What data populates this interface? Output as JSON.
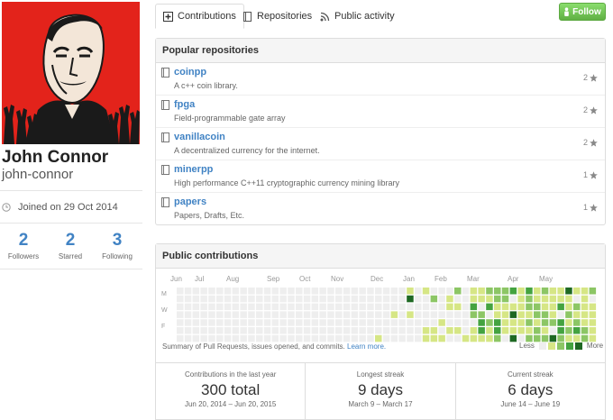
{
  "profile": {
    "fullname": "John Connor",
    "username": "john-connor",
    "joined": "Joined on 29 Oct 2014",
    "stats": [
      {
        "num": "2",
        "label": "Followers"
      },
      {
        "num": "2",
        "label": "Starred"
      },
      {
        "num": "3",
        "label": "Following"
      }
    ]
  },
  "tabs": [
    {
      "label": "Contributions",
      "icon": "contributions-icon",
      "active": true
    },
    {
      "label": "Repositories",
      "icon": "repo-icon",
      "active": false
    },
    {
      "label": "Public activity",
      "icon": "rss-icon",
      "active": false
    }
  ],
  "follow": {
    "label": "Follow"
  },
  "popular": {
    "title": "Popular repositories",
    "repos": [
      {
        "name": "coinpp",
        "desc": "A c++ coin library.",
        "stars": "2"
      },
      {
        "name": "fpga",
        "desc": "Field-programmable gate array",
        "stars": "2"
      },
      {
        "name": "vanillacoin",
        "desc": "A decentralized currency for the internet.",
        "stars": "2"
      },
      {
        "name": "minerpp",
        "desc": "High performance C++11 cryptographic currency mining library",
        "stars": "1"
      },
      {
        "name": "papers",
        "desc": "Papers, Drafts, Etc.",
        "stars": "1"
      }
    ]
  },
  "contrib": {
    "title": "Public contributions",
    "months": [
      "Jun",
      "Jul",
      "Aug",
      "Sep",
      "Oct",
      "Nov",
      "Dec",
      "Jan",
      "Feb",
      "Mar",
      "Apr",
      "May"
    ],
    "days": [
      "M",
      "W",
      "F"
    ],
    "summary": "Summary of Pull Requests, issues opened, and commits.",
    "learn_more": "Learn more.",
    "legend_less": "Less",
    "legend_more": "More",
    "colors": [
      "#eeeeee",
      "#d6e685",
      "#8cc665",
      "#44a340",
      "#1e6823"
    ]
  },
  "cstats": [
    {
      "title": "Contributions in the last year",
      "value": "300 total",
      "range": "Jun 20, 2014 – Jun 20, 2015"
    },
    {
      "title": "Longest streak",
      "value": "9 days",
      "range": "March 9 – March 17"
    },
    {
      "title": "Current streak",
      "value": "6 days",
      "range": "June 14 – June 19"
    }
  ]
}
